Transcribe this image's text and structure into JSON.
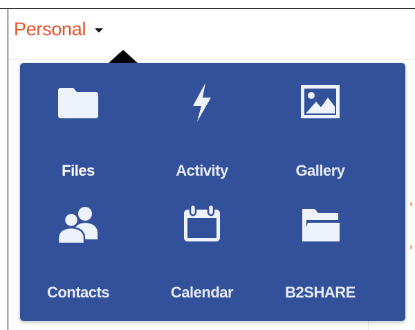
{
  "menu": {
    "title": "Personal"
  },
  "apps": [
    {
      "label": "Files",
      "icon": "folder-icon",
      "active": true
    },
    {
      "label": "Activity",
      "icon": "lightning-icon",
      "active": false
    },
    {
      "label": "Gallery",
      "icon": "image-icon",
      "active": false
    },
    {
      "label": "Contacts",
      "icon": "people-icon",
      "active": false
    },
    {
      "label": "Calendar",
      "icon": "calendar-icon",
      "active": false
    },
    {
      "label": "B2SHARE",
      "icon": "folder-open-icon",
      "active": false
    }
  ],
  "colors": {
    "menu_background": "#33519b",
    "menu_title": "#e4522b",
    "icon_color": "#eef2fa"
  }
}
